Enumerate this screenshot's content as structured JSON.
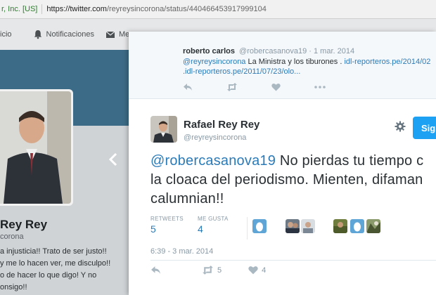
{
  "browser": {
    "cert": "r, Inc. [US]",
    "url_host": "https://twitter.com",
    "url_path": "/reyreysincorona/status/440466453917999104"
  },
  "background_page": {
    "nav": [
      {
        "label": "icio",
        "icon": "home-icon"
      },
      {
        "label": "Notificaciones",
        "icon": "bell-icon"
      },
      {
        "label": "Me",
        "icon": "envelope-icon"
      }
    ],
    "profile_name": "Rey Rey",
    "profile_handle": "corona",
    "bio_lines": [
      "a injusticia!! Trato de ser justo!!",
      "y me lo hacen ver, me disculpo!!",
      "o de hacer lo que digo! Y no",
      "onsigo!!"
    ]
  },
  "reply_tweet": {
    "name": "roberto carlos",
    "handle": "@robercasanova19",
    "date": "· 1 mar. 2014",
    "line1_mention": "@reyreysincorona",
    "line1_text": " La Ministra y los tiburones . ",
    "line1_link": "idl-reporteros.pe/2014/02",
    "line2_link": ".idl-reporteros.pe/2011/07/23/olo..."
  },
  "main_tweet": {
    "name": "Rafael Rey Rey",
    "handle": "@reyreysincorona",
    "follow_label": "Sig",
    "mention": "@robercasanova19",
    "line1_rest": " No pierdas tu tiempo c",
    "line2": "la cloaca del periodismo. Mienten, difaman",
    "line3": "calumnian!!",
    "retweets_label": "RETWEETS",
    "retweets_count": "5",
    "likes_label": "ME GUSTA",
    "likes_count": "4",
    "timestamp": "6:39 - 3 mar. 2014",
    "action_retweet_count": "5",
    "action_like_count": "4"
  },
  "colors": {
    "accent": "#1da1f2",
    "link": "#2b7bb9",
    "muted": "#8899a6"
  }
}
